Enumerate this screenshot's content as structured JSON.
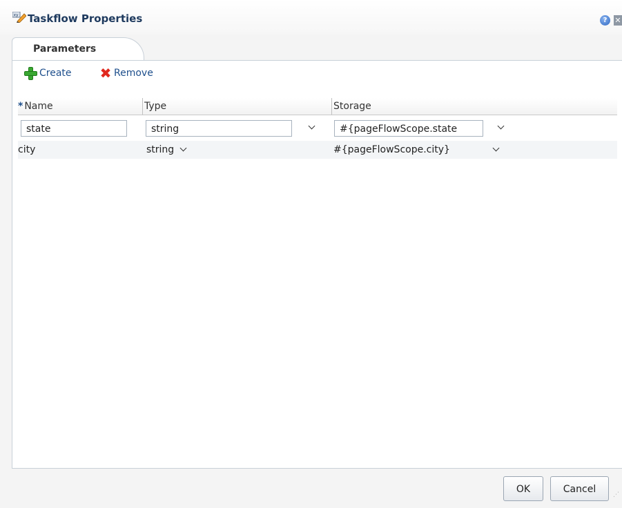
{
  "dialog": {
    "title": "Taskflow Properties",
    "icons": {
      "title": "xy-edit-icon",
      "help": "help-icon",
      "close": "close-icon",
      "help_glyph": "?",
      "close_glyph": "✕"
    }
  },
  "tabs": [
    {
      "label": "Parameters",
      "selected": true
    }
  ],
  "toolbar": {
    "create_label": "Create",
    "remove_label": "Remove"
  },
  "grid": {
    "required_marker": "*",
    "columns": [
      "Name",
      "Type",
      "Storage"
    ],
    "rows": [
      {
        "name": "state",
        "type": "string",
        "storage": "#{pageFlowScope.state",
        "editing": true
      },
      {
        "name": "city",
        "type": "string",
        "storage": "#{pageFlowScope.city}",
        "editing": false
      }
    ]
  },
  "footer": {
    "ok_label": "OK",
    "cancel_label": "Cancel"
  },
  "colors": {
    "title": "#1e3a5e",
    "link": "#1e4f8c",
    "create_icon": "#3aa832",
    "remove_icon": "#e0281e"
  }
}
